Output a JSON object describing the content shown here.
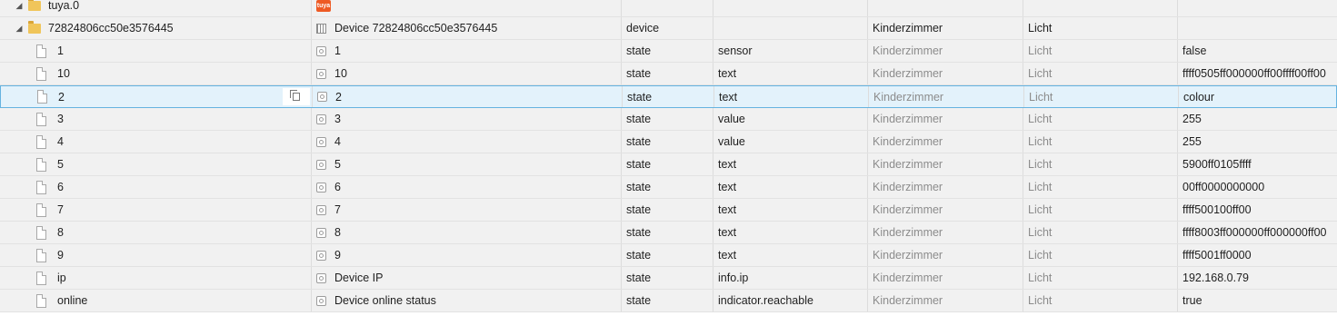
{
  "top_row": {
    "id": "tuya.0",
    "logo": "tuya"
  },
  "device_row": {
    "id": "72824806cc50e3576445",
    "name": "Device 72824806cc50e3576445",
    "type": "device",
    "role": "",
    "room": "Kinderzimmer",
    "function": "Licht",
    "value": ""
  },
  "states": [
    {
      "id": "1",
      "name": "1",
      "type": "state",
      "role": "sensor",
      "room": "Kinderzimmer",
      "function": "Licht",
      "value": "false"
    },
    {
      "id": "10",
      "name": "10",
      "type": "state",
      "role": "text",
      "room": "Kinderzimmer",
      "function": "Licht",
      "value": "ffff0505ff000000ff00ffff00ff00"
    },
    {
      "id": "2",
      "name": "2",
      "type": "state",
      "role": "text",
      "room": "Kinderzimmer",
      "function": "Licht",
      "value": "colour"
    },
    {
      "id": "3",
      "name": "3",
      "type": "state",
      "role": "value",
      "room": "Kinderzimmer",
      "function": "Licht",
      "value": "255"
    },
    {
      "id": "4",
      "name": "4",
      "type": "state",
      "role": "value",
      "room": "Kinderzimmer",
      "function": "Licht",
      "value": "255"
    },
    {
      "id": "5",
      "name": "5",
      "type": "state",
      "role": "text",
      "room": "Kinderzimmer",
      "function": "Licht",
      "value": "5900ff0105ffff"
    },
    {
      "id": "6",
      "name": "6",
      "type": "state",
      "role": "text",
      "room": "Kinderzimmer",
      "function": "Licht",
      "value": "00ff0000000000"
    },
    {
      "id": "7",
      "name": "7",
      "type": "state",
      "role": "text",
      "room": "Kinderzimmer",
      "function": "Licht",
      "value": "ffff500100ff00"
    },
    {
      "id": "8",
      "name": "8",
      "type": "state",
      "role": "text",
      "room": "Kinderzimmer",
      "function": "Licht",
      "value": "ffff8003ff000000ff000000ff00"
    },
    {
      "id": "9",
      "name": "9",
      "type": "state",
      "role": "text",
      "room": "Kinderzimmer",
      "function": "Licht",
      "value": "ffff5001ff0000"
    },
    {
      "id": "ip",
      "name": "Device IP",
      "type": "state",
      "role": "info.ip",
      "room": "Kinderzimmer",
      "function": "Licht",
      "value": "192.168.0.79"
    },
    {
      "id": "online",
      "name": "Device online status",
      "type": "state",
      "role": "indicator.reachable",
      "room": "Kinderzimmer",
      "function": "Licht",
      "value": "true"
    }
  ],
  "icons": {
    "expanded": "triangle-down-icon",
    "folder": "folder-icon",
    "file": "file-icon",
    "state": "state-icon",
    "device": "device-icon",
    "copy": "copy-icon"
  },
  "colors": {
    "selection_bg": "#e3f2fb",
    "selection_border": "#65b3e0",
    "row_bg": "#f1f1f1",
    "tuya": "#ee5a24"
  }
}
